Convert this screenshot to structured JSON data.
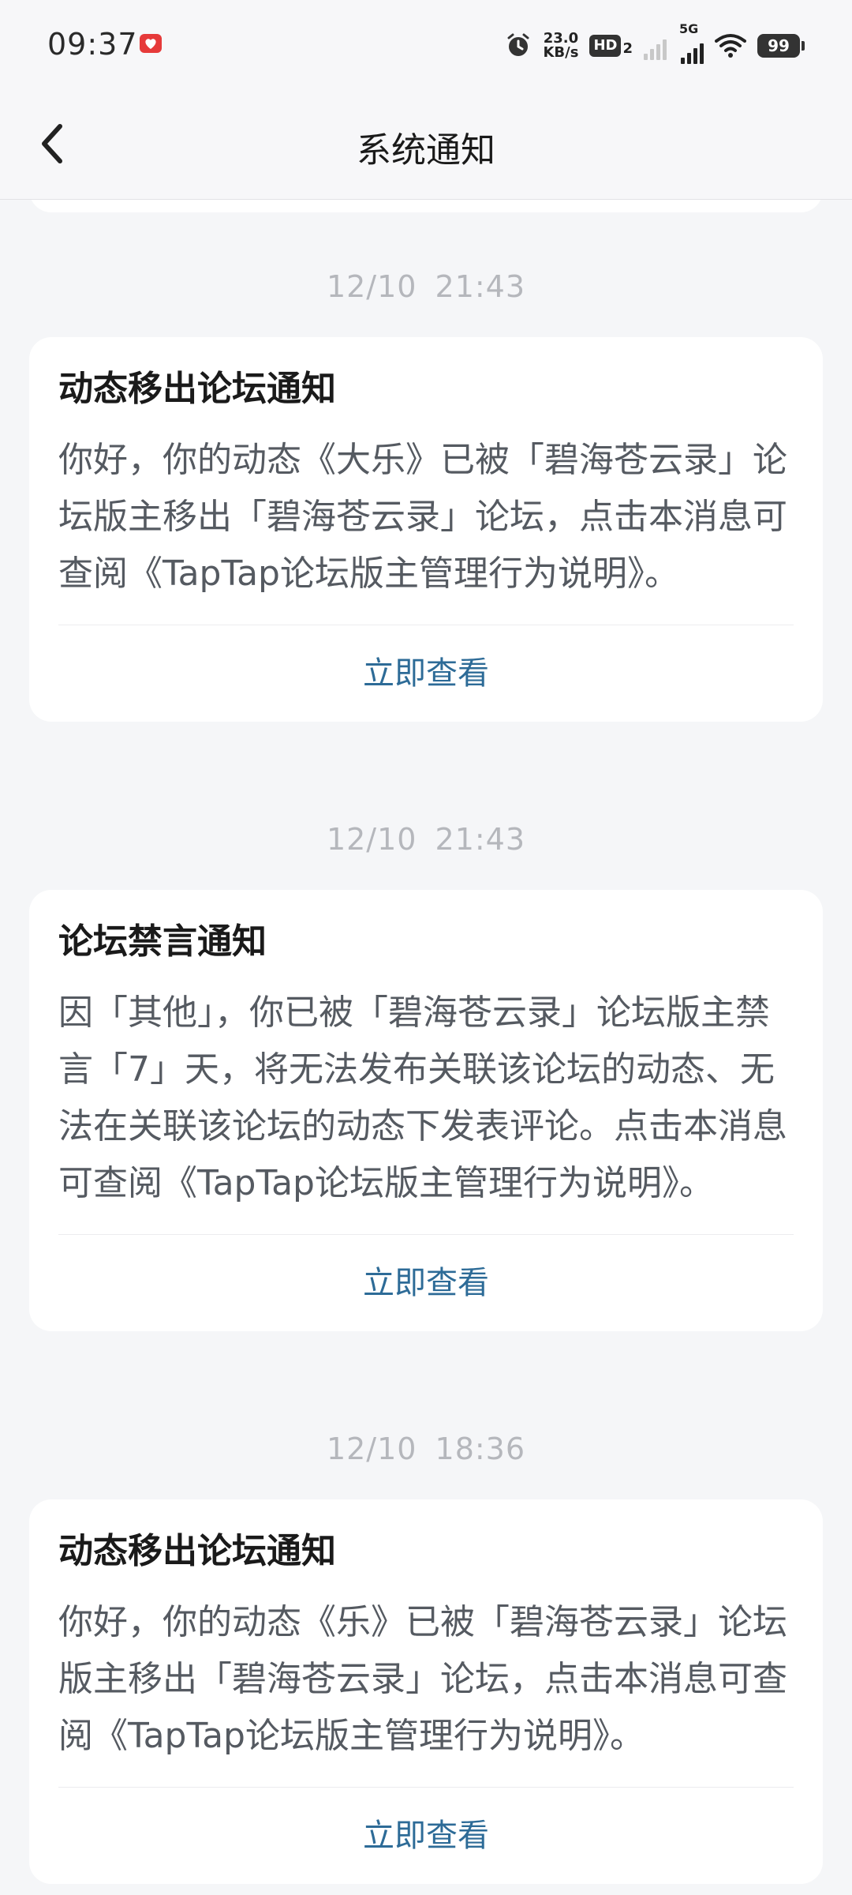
{
  "status_bar": {
    "time": "09:37",
    "net_speed_value": "23.0",
    "net_speed_unit": "KB/s",
    "hd_label": "HD",
    "hd_sub": "2",
    "sim_label": "5G",
    "battery": "99"
  },
  "header": {
    "title": "系统通知"
  },
  "notices": [
    {
      "timestamp": "12/10  21:43",
      "title": "动态移出论坛通知",
      "body": "你好，你的动态《大乐》已被「碧海苍云录」论坛版主移出「碧海苍云录」论坛，点击本消息可查阅《TapTap论坛版主管理行为说明》。",
      "action_label": "立即查看"
    },
    {
      "timestamp": "12/10  21:43",
      "title": "论坛禁言通知",
      "body": "因「其他」，你已被「碧海苍云录」论坛版主禁言「7」天，将无法发布关联该论坛的动态、无法在关联该论坛的动态下发表评论。点击本消息可查阅《TapTap论坛版主管理行为说明》。",
      "action_label": "立即查看"
    },
    {
      "timestamp": "12/10  18:36",
      "title": "动态移出论坛通知",
      "body": "你好，你的动态《乐》已被「碧海苍云录」论坛版主移出「碧海苍云录」论坛，点击本消息可查阅《TapTap论坛版主管理行为说明》。",
      "action_label": "立即查看"
    }
  ],
  "colors": {
    "background": "#f5f6f8",
    "card": "#ffffff",
    "link": "#2d6b97",
    "timestamp": "#b5b7bc"
  }
}
